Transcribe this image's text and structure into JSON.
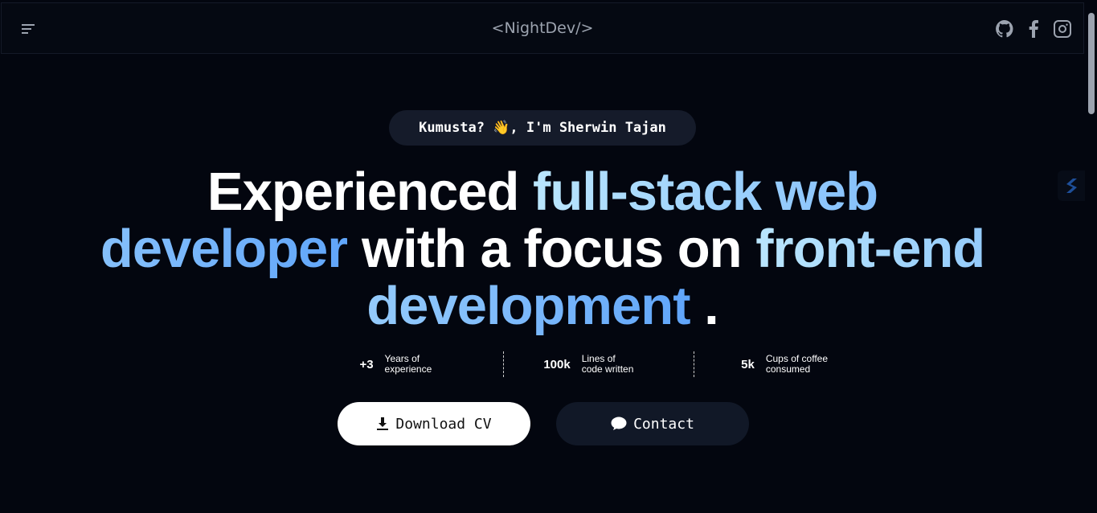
{
  "header": {
    "logo": "<NightDev/>",
    "icons": [
      "menu-icon",
      "github-icon",
      "facebook-icon",
      "instagram-icon"
    ]
  },
  "hero": {
    "greeting": "Kumusta? 👋, I'm Sherwin Tajan",
    "headline": {
      "w1": "Experienced ",
      "h1": "full-stack web developer",
      "w2": " with a focus on ",
      "h2": "front-end development",
      "w3": " ."
    },
    "stats": [
      {
        "value": "+3",
        "label_1": "Years of",
        "label_2": "experience"
      },
      {
        "value": "100k",
        "label_1": "Lines of",
        "label_2": "code written"
      },
      {
        "value": "5k",
        "label_1": "Cups of coffee",
        "label_2": "consumed"
      }
    ],
    "download_label": "Download CV",
    "contact_label": "Contact"
  },
  "colors": {
    "background": "#03060f",
    "gradient_start": "#bae6fd",
    "gradient_end": "#60a5fa"
  }
}
